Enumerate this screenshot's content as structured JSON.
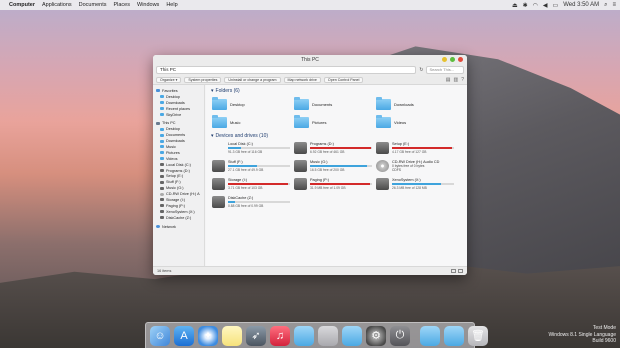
{
  "menubar": {
    "items": [
      "Computer",
      "Applications",
      "Documents",
      "Places",
      "Windows",
      "Help"
    ],
    "clock": "Wed 3:50 AM"
  },
  "window": {
    "title": "This PC",
    "address": "This PC",
    "search_placeholder": "Search This...",
    "toolbar": [
      "Organize",
      "System properties",
      "Uninstall or change a program",
      "Map network drive",
      "Open Control Panel"
    ],
    "status": "16 items"
  },
  "sidebar": {
    "favorites_label": "Favorites",
    "favorites": [
      "Desktop",
      "Downloads",
      "Recent places",
      "SkyDrive"
    ],
    "thispc_label": "This PC",
    "thispc": [
      "Desktop",
      "Documents",
      "Downloads",
      "Music",
      "Pictures",
      "Videos",
      "Local Disk (C:)",
      "Programs (D:)",
      "Setup (E:)",
      "Stuff (F:)",
      "Music (G:)",
      "CD-RW Drive (H:) A",
      "Storage (I:)",
      "Paging (P:)",
      "XenoSystem (X:)",
      "DiskCache (Z:)"
    ],
    "network_label": "Network"
  },
  "folders": {
    "heading": "Folders (6)",
    "items": [
      "Desktop",
      "Documents",
      "Downloads",
      "Music",
      "Pictures",
      "Videos"
    ]
  },
  "drives": {
    "heading": "Devices and drives (10)",
    "items": [
      {
        "name": "Local Disk (C:)",
        "free": "91.3 GB free of 116 GB",
        "used_fraction": 0.21,
        "bar_color": "#3ea3dc",
        "icon": "apple"
      },
      {
        "name": "Programs (D:)",
        "free": "6.92 GB free of 461 GB",
        "used_fraction": 0.98,
        "bar_color": "#d32a2a",
        "icon": "hdd"
      },
      {
        "name": "Setup (E:)",
        "free": "4.17 GB free of 127 GB",
        "used_fraction": 0.97,
        "bar_color": "#d32a2a",
        "icon": "hdd"
      },
      {
        "name": "Stuff (F:)",
        "free": "27.1 GB free of 49.9 GB",
        "used_fraction": 0.46,
        "bar_color": "#3ea3dc",
        "icon": "hdd"
      },
      {
        "name": "Music (G:)",
        "free": "16.5 GB free of 200 GB",
        "used_fraction": 0.92,
        "bar_color": "#3ea3dc",
        "icon": "hdd"
      },
      {
        "name": "CD-RW Drive (H:) Audio CD",
        "sub": "0 bytes free of 0 bytes",
        "sub2": "CDFS",
        "icon": "cd"
      },
      {
        "name": "Storage (I:)",
        "free": "3.71 GB free of 103 GB",
        "used_fraction": 0.96,
        "bar_color": "#d32a2a",
        "icon": "hdd"
      },
      {
        "name": "Paging (P:)",
        "free": "31.9 MB free of 1.09 GB",
        "used_fraction": 0.97,
        "bar_color": "#d32a2a",
        "icon": "hdd"
      },
      {
        "name": "XenoSystem (X:)",
        "free": "26.3 MB free of 128 MB",
        "used_fraction": 0.79,
        "bar_color": "#3ea3dc",
        "icon": "hdd"
      },
      {
        "name": "DiskCache (Z:)",
        "free": "0.88 GB free of 0.99 GB",
        "used_fraction": 0.11,
        "bar_color": "#3ea3dc",
        "icon": "hdd"
      }
    ]
  },
  "dock": [
    "finder",
    "app-store",
    "safari",
    "notes",
    "launchpad",
    "itunes",
    "folder",
    "system",
    "folder",
    "system-preferences",
    "power",
    "folder",
    "folder",
    "trash"
  ],
  "watermark": {
    "line1": "Test Mode",
    "line2": "Windows 8.1 Single Language",
    "line3": "Build 9600"
  }
}
